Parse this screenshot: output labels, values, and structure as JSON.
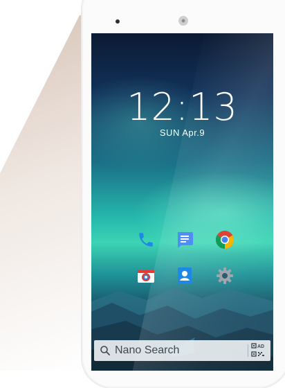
{
  "lockscreen": {
    "time": "12:13",
    "date": "SUN Apr.9"
  },
  "apps": [
    {
      "name": "Phone",
      "icon": "phone-icon"
    },
    {
      "name": "Messages",
      "icon": "messages-icon"
    },
    {
      "name": "Chrome",
      "icon": "chrome-icon"
    },
    {
      "name": "Camera",
      "icon": "camera-icon"
    },
    {
      "name": "Contacts",
      "icon": "contacts-icon"
    },
    {
      "name": "Settings",
      "icon": "settings-icon"
    }
  ],
  "search": {
    "placeholder": "Nano Search",
    "qr_label": "AD"
  },
  "colors": {
    "accent_blue": "#1e88e5",
    "screen_teal": "#3cd4b4",
    "search_bar": "#ebf0f2"
  }
}
